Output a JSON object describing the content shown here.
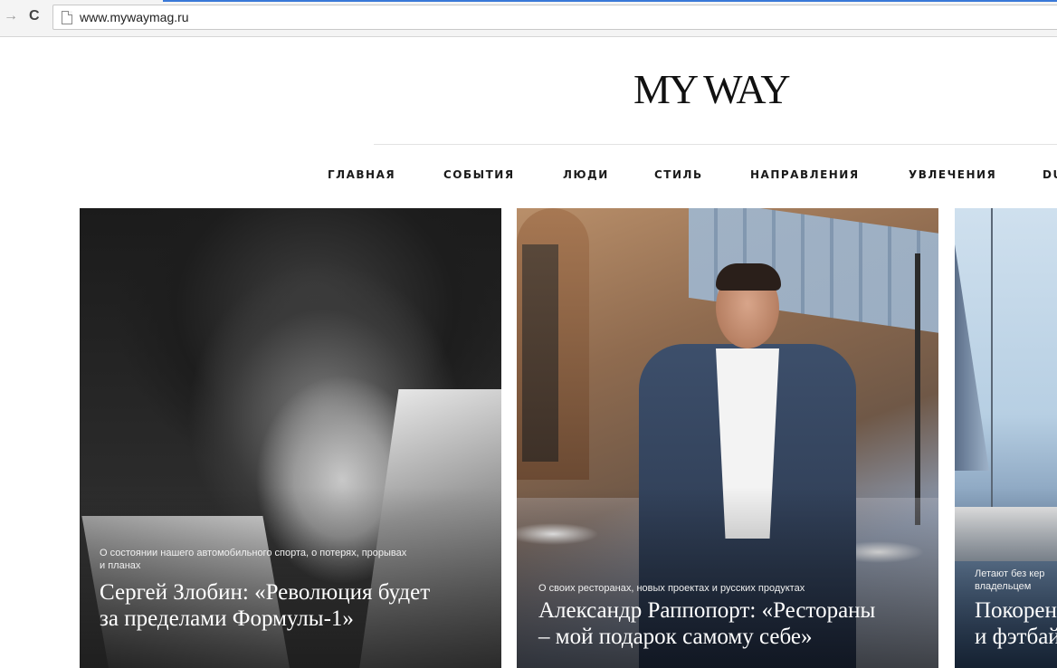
{
  "browser": {
    "back_glyph": "→",
    "reload_glyph": "C",
    "url": "www.mywaymag.ru"
  },
  "site": {
    "logo": "MY WAY"
  },
  "nav": {
    "items": [
      {
        "label": "ГЛАВНАЯ"
      },
      {
        "label": "СОБЫТИЯ"
      },
      {
        "label": "ЛЮДИ"
      },
      {
        "label": "СТИЛЬ"
      },
      {
        "label": "НАПРАВЛЕНИЯ"
      },
      {
        "label": "УВЛЕЧЕНИЯ"
      },
      {
        "label": "DU"
      }
    ]
  },
  "cards": [
    {
      "kicker_line1": "О состоянии нашего автомобильного спорта, о потерях, прорывах",
      "kicker_line2": "и планах",
      "headline_line1": "Сергей Злобин: «Революция будет",
      "headline_line2": "за пределами Формулы-1»"
    },
    {
      "kicker_line1": "О своих ресторанах, новых проектах и русских продуктах",
      "headline_line1": "Александр Раппопорт: «Рестораны",
      "headline_line2": "– мой подарок самому себе»"
    },
    {
      "kicker_line1": "Летают без кер",
      "kicker_line2": "владельцем",
      "headline_line1": "Покорен",
      "headline_line2": "и фэтбай"
    }
  ],
  "colors": {
    "address_accent": "#3a78d8",
    "text_dark": "#1a1a1a"
  }
}
